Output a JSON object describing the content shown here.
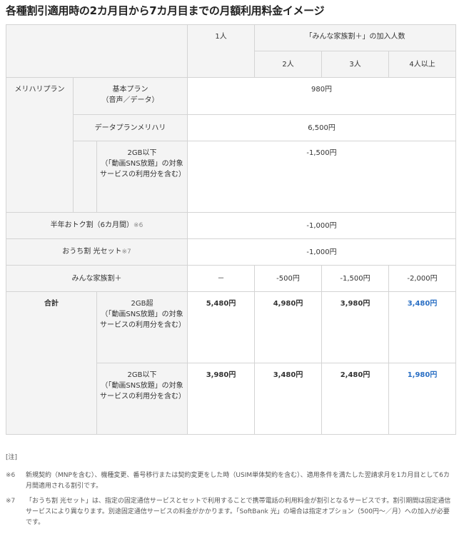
{
  "title": "各種割引適用時の2カ月目から7カ月目までの月額利用料金イメージ",
  "table": {
    "header": {
      "one_person": "1人",
      "family_group": "「みんな家族割＋」の加入人数",
      "two": "2人",
      "three": "3人",
      "four_plus": "4人以上"
    },
    "plan_label": "メリハリプラン",
    "basic_label": "基本プラン\n（音声／データ）",
    "basic_value": "980円",
    "data_label": "データプランメリハリ",
    "data_value": "6,500円",
    "under2gb_label": "2GB以下\n（「動画SNS放題」の対象サービスの利用分を含む）",
    "under2gb_value": "-1,500円",
    "halfyear_label": "半年おトク割（6カ月間）",
    "halfyear_note": "※6",
    "halfyear_value": "-1,000円",
    "ouchi_label": "おうち割 光セット",
    "ouchi_note": "※7",
    "ouchi_value": "-1,000円",
    "family_label": "みんな家族割＋",
    "family_values": [
      "－",
      "-500円",
      "-1,500円",
      "-2,000円"
    ],
    "total_label": "合計",
    "over2gb_label": "2GB超\n（「動画SNS放題」の対象サービスの利用分を含む）",
    "over2gb_values": [
      "5,480円",
      "4,980円",
      "3,980円",
      "3,480円"
    ],
    "under2gb_total_label": "2GB以下\n（「動画SNS放題」の対象サービスの利用分を含む）",
    "under2gb_total_values": [
      "3,980円",
      "3,480円",
      "2,480円",
      "1,980円"
    ]
  },
  "notes": {
    "header": "[注]",
    "items": [
      {
        "mark": "※6",
        "text": "新規契約（MNPを含む）、機種変更、番号移行または契約変更をした時（USIM単体契約を含む）、適用条件を満たした翌請求月を1カ月目として6カ月間適用される割引です。"
      },
      {
        "mark": "※7",
        "text": "「おうち割 光セット」は、指定の固定通信サービスとセットで利用することで携帯電話の利用料金が割引となるサービスです。割引期間は固定通信サービスにより異なります。別途固定通信サービスの料金がかかります。「SoftBank 光」の場合は指定オプション（500円～／月）への加入が必要です。"
      }
    ]
  },
  "colors": {
    "header_bg": "#f4f4f4",
    "border": "#d4d4d4",
    "highlight": "#2a6fc4"
  }
}
